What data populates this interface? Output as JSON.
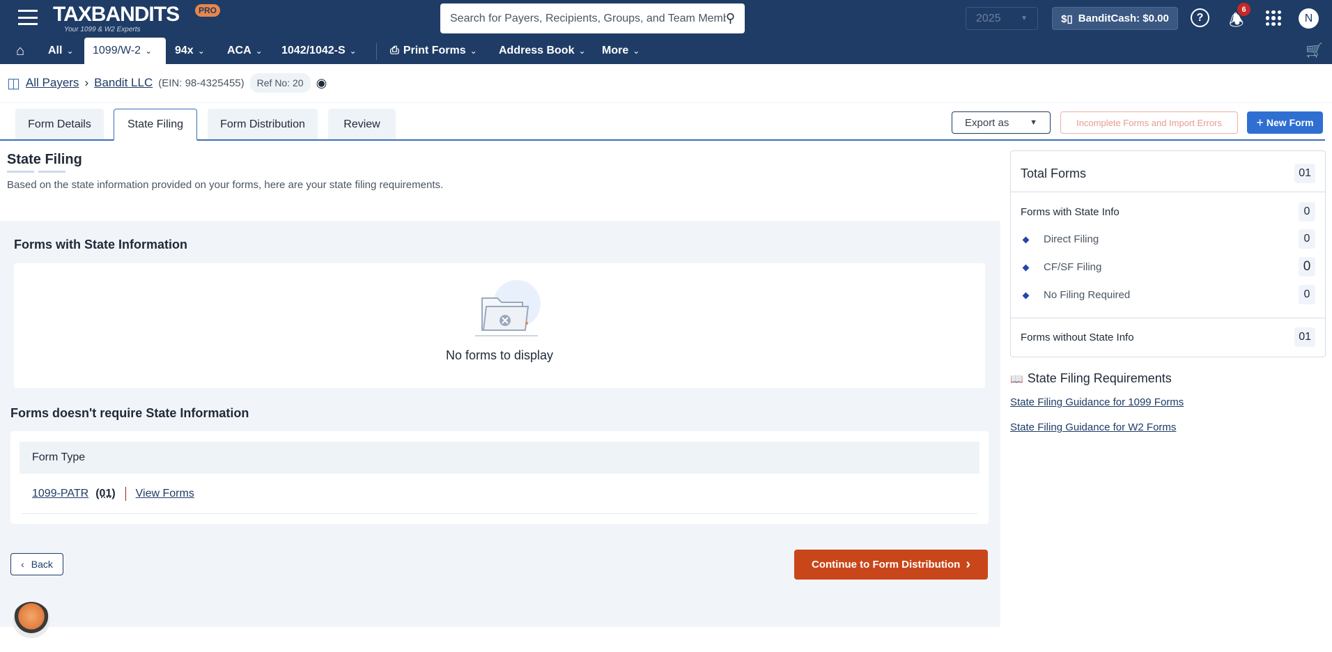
{
  "header": {
    "brand": "TAXBANDITS",
    "brand_badge": "PRO",
    "tagline": "Your 1099 & W2 Experts",
    "search_placeholder": "Search for Payers, Recipients, Groups, and Team Members",
    "year": "2025",
    "bandit_cash": "BanditCash: $0.00",
    "notification_count": "6",
    "avatar_initial": "N"
  },
  "nav": {
    "items": [
      {
        "label": "All"
      },
      {
        "label": "1099/W-2"
      },
      {
        "label": "94x"
      },
      {
        "label": "ACA"
      },
      {
        "label": "1042/1042-S"
      },
      {
        "label": "Print Forms"
      },
      {
        "label": "Address Book"
      },
      {
        "label": "More"
      }
    ]
  },
  "breadcrumb": {
    "all_payers": "All Payers",
    "payer": "Bandit LLC",
    "ein": "(EIN: 98-4325455)",
    "ref": "Ref No: 20"
  },
  "tabs": [
    {
      "label": "Form Details"
    },
    {
      "label": "State Filing"
    },
    {
      "label": "Form Distribution"
    },
    {
      "label": "Review"
    }
  ],
  "actions": {
    "export": "Export as",
    "incomplete": "Incomplete Forms and Import Errors",
    "new_form": "New Form"
  },
  "page": {
    "title": "State Filing",
    "description": "Based on the state information provided on your forms, here are your state filing requirements."
  },
  "with_state": {
    "title": "Forms with State Information",
    "empty": "No forms to display"
  },
  "without_state": {
    "title": "Forms doesn't require State Information",
    "column": "Form Type",
    "rows": [
      {
        "form": "1099-PATR",
        "count": "(01)",
        "view": "View Forms"
      }
    ]
  },
  "footer": {
    "back": "Back",
    "continue": "Continue to Form Distribution"
  },
  "summary": {
    "total_label": "Total Forms",
    "total": "01",
    "with_label": "Forms with State Info",
    "with": "0",
    "items": [
      {
        "label": "Direct Filing",
        "value": "0"
      },
      {
        "label": "CF/SF Filing",
        "value": "0"
      },
      {
        "label": "No Filing Required",
        "value": "0"
      }
    ],
    "without_label": "Forms without State Info",
    "without": "01"
  },
  "requirements": {
    "title": "State Filing Requirements",
    "links": [
      "State Filing Guidance for 1099 Forms",
      "State Filing Guidance for W2 Forms"
    ]
  },
  "colors": {
    "header": "#1f3c66",
    "primary": "#2f6fd1",
    "continue": "#c9461a"
  }
}
